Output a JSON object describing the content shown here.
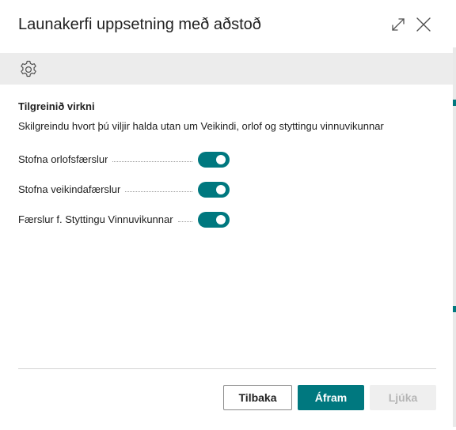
{
  "dialog": {
    "title": "Launakerfi uppsetning með aðstoð",
    "icons": {
      "expand": "expand-icon",
      "close": "close-icon",
      "settings": "gear-icon"
    }
  },
  "section": {
    "title": "Tilgreinið virkni",
    "description": "Skilgreindu hvort þú viljir halda utan um Veikindi, orlof og styttingu vinnuvikunnar"
  },
  "fields": [
    {
      "label": "Stofna orlofsfærslur",
      "enabled": true
    },
    {
      "label": "Stofna veikindafærslur",
      "enabled": true
    },
    {
      "label": "Færslur f. Styttingu Vinnuvikunnar",
      "enabled": true
    }
  ],
  "buttons": {
    "back": "Tilbaka",
    "next": "Áfram",
    "finish": "Ljúka"
  },
  "colors": {
    "accent": "#00787f",
    "toolbar_bg": "#ececec",
    "disabled_bg": "#efefef",
    "disabled_text": "#b5b5b5"
  }
}
